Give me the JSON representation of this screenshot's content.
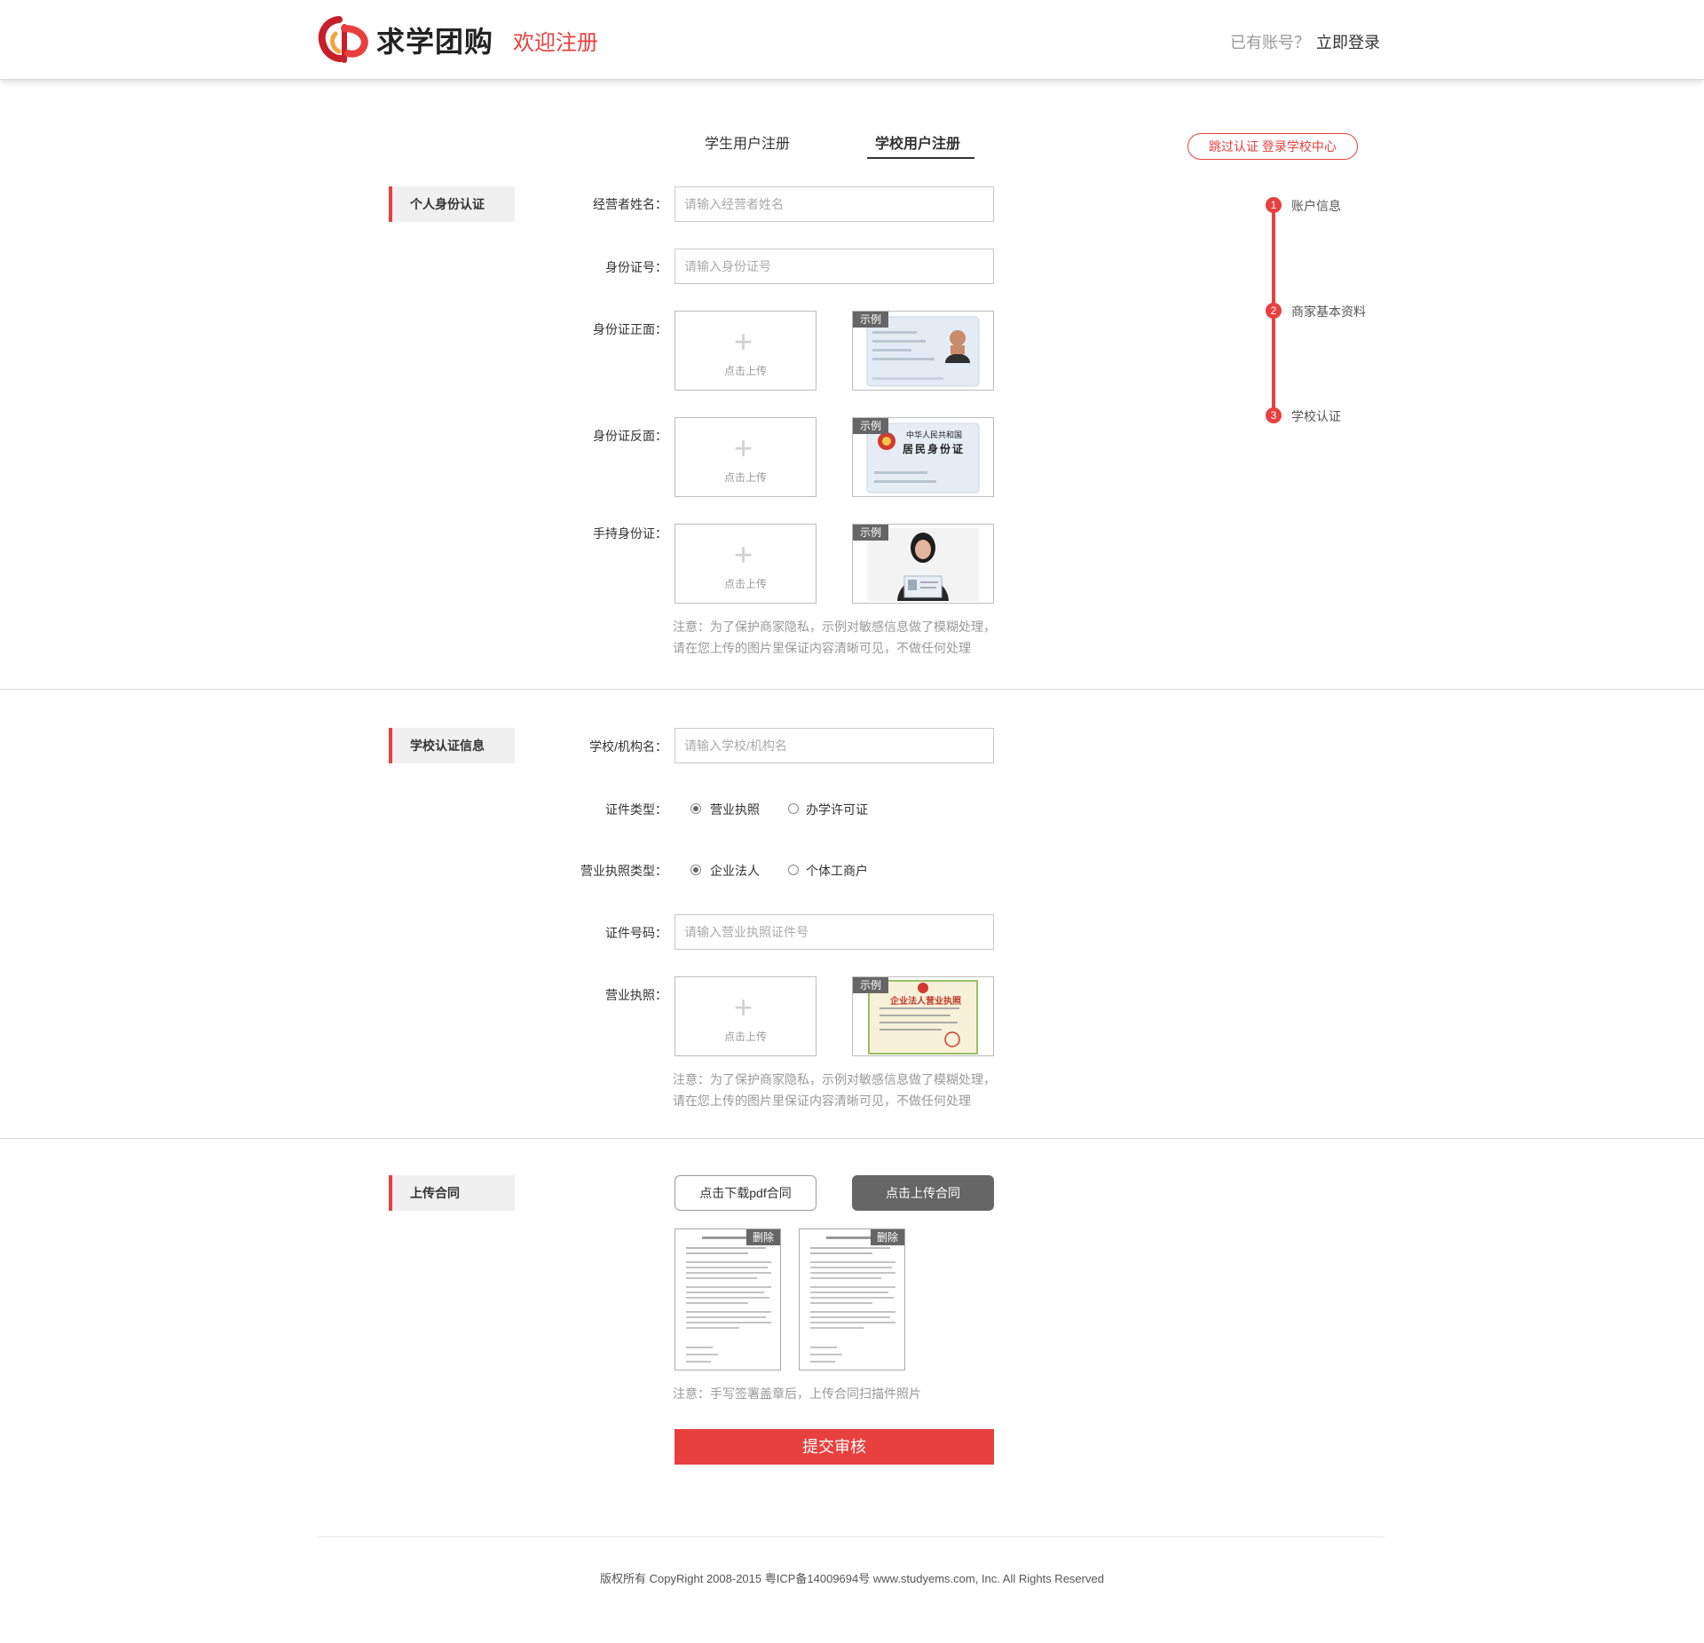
{
  "header": {
    "brand": "求学团购",
    "welcome": "欢迎注册",
    "login_question": "已有账号？",
    "login_link": "立即登录"
  },
  "tabs": [
    {
      "label": "学生用户注册",
      "active": false
    },
    {
      "label": "学校用户注册",
      "active": true
    }
  ],
  "skip_button": "跳过认证 登录学校中心",
  "steps": [
    {
      "num": "1",
      "label": "账户信息"
    },
    {
      "num": "2",
      "label": "商家基本资料"
    },
    {
      "num": "3",
      "label": "学校认证"
    }
  ],
  "personal": {
    "heading": "个人身份认证",
    "name_label": "经营者姓名：",
    "name_placeholder": "请输入经营者姓名",
    "id_label": "身份证号：",
    "id_placeholder": "请输入身份证号",
    "front_label": "身份证正面：",
    "back_label": "身份证反面：",
    "hold_label": "手持身份证：",
    "note_line1": "注意：为了保护商家隐私，示例对敏感信息做了模糊处理，",
    "note_line2": "请在您上传的图片里保证内容清晰可见，不做任何处理"
  },
  "upload": {
    "plus": "+",
    "text": "点击上传",
    "sample_tag": "示例"
  },
  "id_back_text": {
    "line1": "中华人民共和国",
    "line2": "居民身份证"
  },
  "license_title": "企业法人营业执照",
  "school": {
    "heading": "学校认证信息",
    "org_label": "学校/机构名：",
    "org_placeholder": "请输入学校/机构名",
    "cert_type_label": "证件类型：",
    "cert_type_options": [
      "营业执照",
      "办学许可证"
    ],
    "license_type_label": "营业执照类型：",
    "license_type_options": [
      "企业法人",
      "个体工商户"
    ],
    "cert_no_label": "证件号码：",
    "cert_no_placeholder": "请输入营业执照证件号",
    "license_label": "营业执照：",
    "note_line1": "注意：为了保护商家隐私，示例对敏感信息做了模糊处理，",
    "note_line2": "请在您上传的图片里保证内容清晰可见，不做任何处理"
  },
  "contract": {
    "heading": "上传合同",
    "download_btn": "点击下载pdf合同",
    "upload_btn": "点击上传合同",
    "delete_label": "删除",
    "note": "注意：手写签署盖章后，上传合同扫描件照片"
  },
  "submit": "提交审核",
  "footer": "版权所有 CopyRight 2008-2015 粤ICP备14009694号 www.studyems.com, Inc. All Rights Reserved",
  "colors": {
    "accent": "#e8403f",
    "dark_button": "#666666",
    "muted_text": "#999999"
  }
}
